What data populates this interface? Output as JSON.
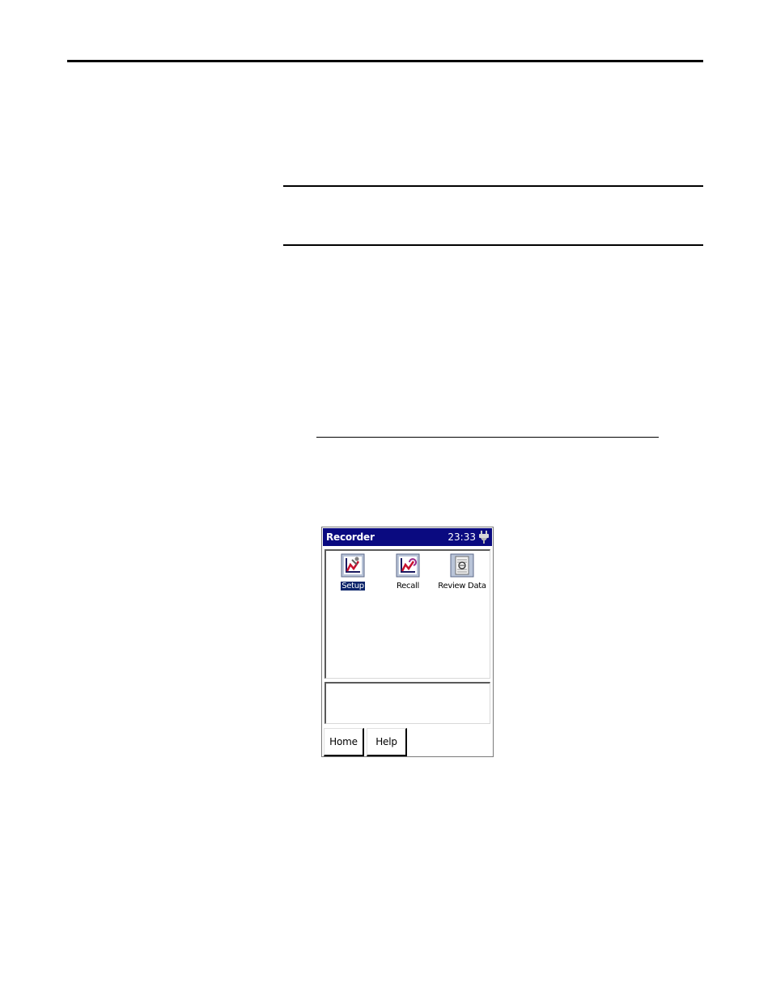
{
  "device": {
    "title": "Recorder",
    "clock": "23:33",
    "status_icon": "power-plug-icon",
    "launchers": [
      {
        "label": "Setup",
        "icon": "setup-chart-icon",
        "selected": true
      },
      {
        "label": "Recall",
        "icon": "recall-chart-icon",
        "selected": false
      },
      {
        "label": "Review Data",
        "icon": "review-data-icon",
        "selected": false
      }
    ],
    "softkeys": {
      "home": "Home",
      "help": "Help"
    },
    "colors": {
      "titlebar": "#0a0a80",
      "selection": "#0a246a"
    }
  }
}
